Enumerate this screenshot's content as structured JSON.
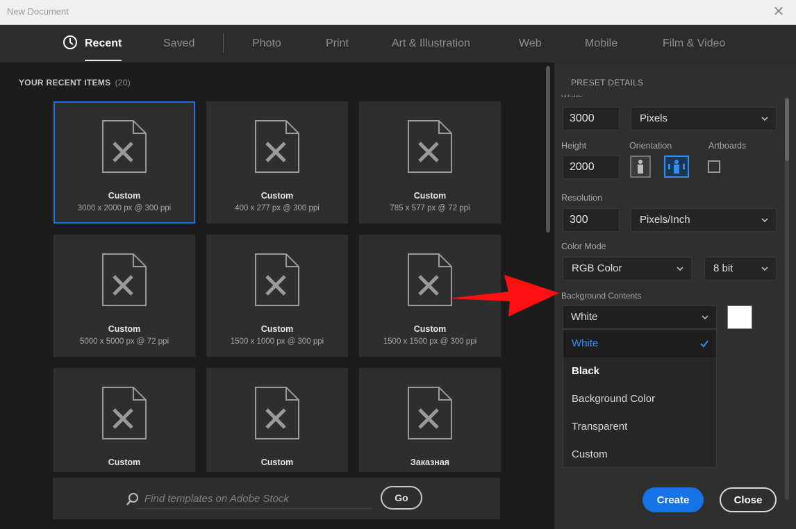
{
  "window": {
    "title": "New Document",
    "close_glyph": "✕"
  },
  "tabs": [
    {
      "label": "Recent",
      "icon": "clock-icon",
      "active": true
    },
    {
      "label": "Saved"
    },
    {
      "label": "Photo"
    },
    {
      "label": "Print"
    },
    {
      "label": "Art & Illustration"
    },
    {
      "label": "Web"
    },
    {
      "label": "Mobile"
    },
    {
      "label": "Film & Video"
    }
  ],
  "recent": {
    "header": "YOUR RECENT ITEMS",
    "count": "(20)",
    "items": [
      {
        "name": "Custom",
        "dims": "3000 x 2000 px @ 300 ppi",
        "selected": true
      },
      {
        "name": "Custom",
        "dims": "400 x 277 px @ 300 ppi"
      },
      {
        "name": "Custom",
        "dims": "785 x 577 px @ 72 ppi"
      },
      {
        "name": "Custom",
        "dims": "5000 x 5000 px @ 72 ppi"
      },
      {
        "name": "Custom",
        "dims": "1500 x 1000 px @ 300 ppi"
      },
      {
        "name": "Custom",
        "dims": "1500 x 1500 px @ 300 ppi"
      },
      {
        "name": "Custom",
        "dims": ""
      },
      {
        "name": "Custom",
        "dims": ""
      },
      {
        "name": "Заказная",
        "dims": ""
      }
    ]
  },
  "search": {
    "placeholder": "Find templates on Adobe Stock",
    "go_label": "Go"
  },
  "preset": {
    "header": "PRESET DETAILS",
    "width_label": "Width",
    "width_value": "3000",
    "width_unit": "Pixels",
    "height_label": "Height",
    "height_value": "2000",
    "orientation_label": "Orientation",
    "orientation_selected": "landscape",
    "artboards_label": "Artboards",
    "artboards_checked": false,
    "resolution_label": "Resolution",
    "resolution_value": "300",
    "resolution_unit": "Pixels/Inch",
    "color_mode_label": "Color Mode",
    "color_mode_value": "RGB Color",
    "bit_depth_value": "8 bit",
    "background_label": "Background Contents",
    "background_value": "White",
    "background_swatch": "#ffffff",
    "background_options": [
      {
        "label": "White",
        "selected": true
      },
      {
        "label": "Black"
      },
      {
        "label": "Background Color"
      },
      {
        "label": "Transparent"
      },
      {
        "label": "Custom"
      }
    ]
  },
  "actions": {
    "create_label": "Create",
    "close_label": "Close"
  },
  "colors": {
    "accent": "#1473e6",
    "arrow": "#ff0000",
    "selected_text": "#3b8ef0"
  }
}
